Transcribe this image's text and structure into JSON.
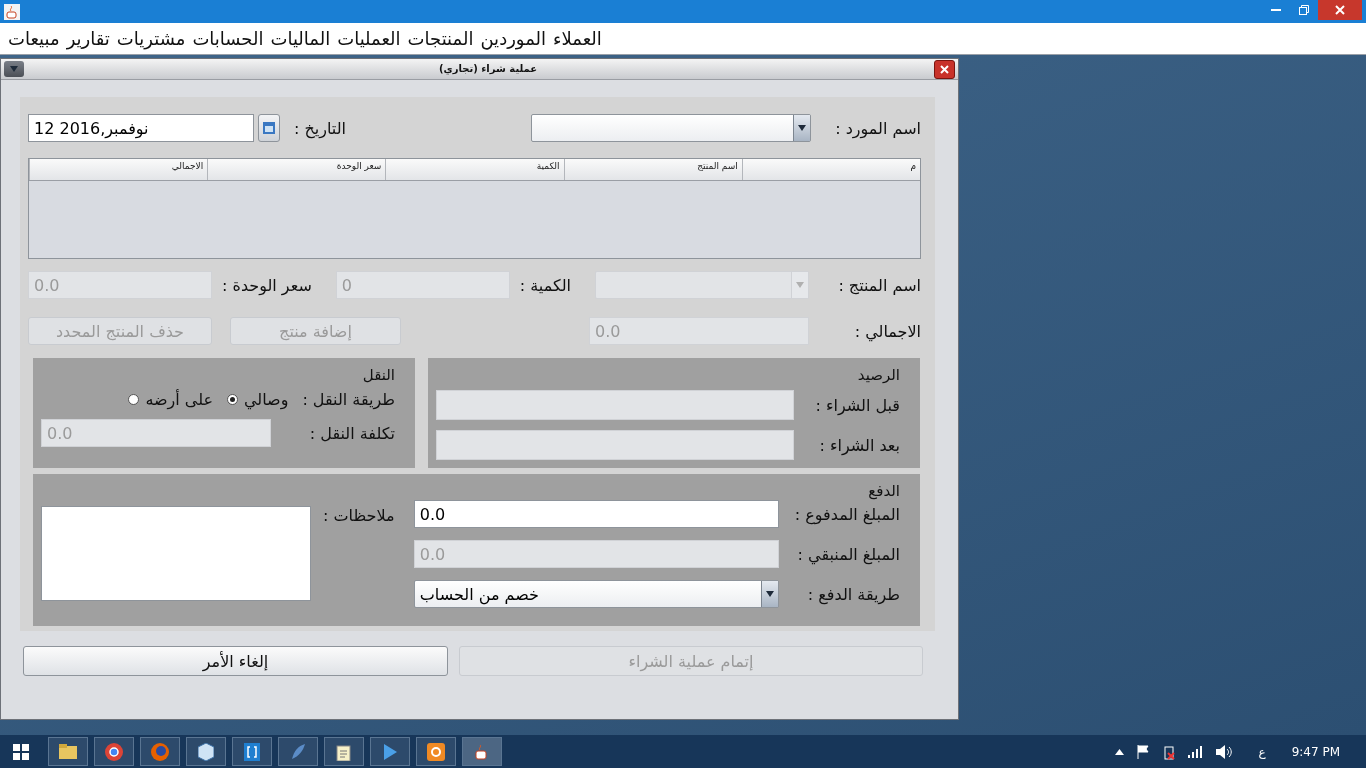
{
  "app_window": {
    "menu": [
      "العملاء",
      "الموردين",
      "المنتجات",
      "العمليات",
      "الماليات",
      "الحسابات",
      "مشتريات",
      "تقارير",
      "مبيعات"
    ]
  },
  "dialog": {
    "title": "عملية شراء  (تجاري)",
    "supplier": {
      "label": "اسم المورد :"
    },
    "date": {
      "label": "التاريخ :",
      "value": "12 2016,نوفمبر"
    },
    "table": {
      "columns": [
        "م",
        "اسم المنتج",
        "الكمية",
        "سعر الوحدة",
        "الاجمالي"
      ]
    },
    "product": {
      "label": "اسم المنتج :",
      "disabled": true
    },
    "quantity": {
      "label": "الكمية :",
      "value": "0",
      "disabled": true
    },
    "unit_price": {
      "label": "سعر الوحدة :",
      "value": "0.0",
      "disabled": true
    },
    "total": {
      "label": "الاجمالي :",
      "value": "0.0",
      "disabled": true
    },
    "item_buttons": [
      {
        "label": "إضافة منتج",
        "disabled": true
      },
      {
        "label": "حذف المنتج المحدد",
        "disabled": true
      }
    ],
    "balance": {
      "title": "الرصيد",
      "fields": [
        {
          "label": "قبل الشراء :"
        },
        {
          "label": "بعد الشراء :"
        }
      ]
    },
    "transport": {
      "title": "النقل",
      "method_label": "طريقة النقل :",
      "methods": [
        {
          "label": "وصالي",
          "selected": true
        },
        {
          "label": "على أرضه",
          "selected": false
        }
      ],
      "cost": {
        "label": "تكلفة النقل :",
        "value": "0.0",
        "disabled": true
      }
    },
    "payment": {
      "title": "الدفع",
      "paid": {
        "label": "المبلغ المدفوع :",
        "value": "0.0",
        "disabled": false
      },
      "remaining": {
        "label": "المبلغ المنبقي :",
        "value": "0.0",
        "disabled": true
      },
      "method": {
        "label": "طريقة الدفع :",
        "value": "خصم من الحساب"
      },
      "notes": {
        "label": "ملاحظات :"
      }
    },
    "buttons": [
      {
        "label": "إتمام عملية الشراء",
        "disabled": true
      },
      {
        "label": "إلغاء الأمر",
        "disabled": false
      }
    ]
  },
  "taskbar": {
    "language": "ع",
    "time": "9:47 PM"
  }
}
